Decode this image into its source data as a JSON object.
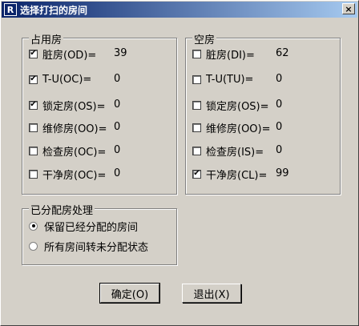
{
  "window": {
    "title": "选择打扫的房间",
    "icon_label": "R",
    "close_label": "×"
  },
  "occupied": {
    "legend": "占用房",
    "items": [
      {
        "label": "脏房(OD)=",
        "value": "39",
        "checked": true
      },
      {
        "label": "T-U(OC)=",
        "value": "0",
        "checked": true
      },
      {
        "label": "锁定房(OS)=",
        "value": "0",
        "checked": true
      },
      {
        "label": "维修房(OO)=",
        "value": "0",
        "checked": false
      },
      {
        "label": "检查房(OC)=",
        "value": "0",
        "checked": false
      },
      {
        "label": "干净房(OC)=",
        "value": "0",
        "checked": false
      }
    ]
  },
  "vacant": {
    "legend": "空房",
    "items": [
      {
        "label": "脏房(DI)=",
        "value": "62",
        "checked": false
      },
      {
        "label": "T-U(TU)=",
        "value": "0",
        "checked": false
      },
      {
        "label": "锁定房(OS)=",
        "value": "0",
        "checked": false
      },
      {
        "label": "维修房(OO)=",
        "value": "0",
        "checked": false
      },
      {
        "label": "检查房(IS)=",
        "value": "0",
        "checked": false
      },
      {
        "label": "干净房(CL)=",
        "value": "99",
        "checked": true
      }
    ]
  },
  "assigned": {
    "legend": "已分配房处理",
    "options": [
      {
        "label": "保留已经分配的房间",
        "selected": true
      },
      {
        "label": "所有房间转未分配状态",
        "selected": false
      }
    ]
  },
  "buttons": {
    "ok": "确定(O)",
    "exit": "退出(X)"
  },
  "check_mark": "✔"
}
